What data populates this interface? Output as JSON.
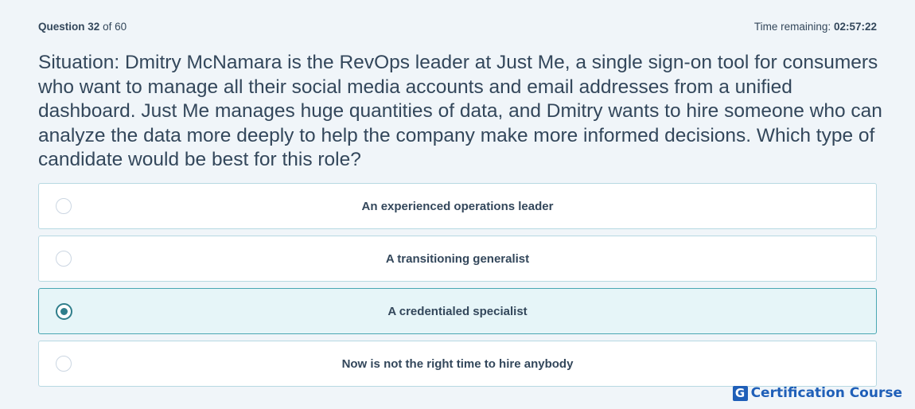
{
  "header": {
    "question_word": "Question",
    "question_number": "32",
    "question_of": "of 60",
    "time_label": "Time remaining:",
    "time_value": "02:57:22"
  },
  "question": {
    "text": "Situation: Dmitry McNamara is the RevOps leader at Just Me, a single sign-on tool for consumers who want to manage all their social media accounts and email addresses from a unified dashboard. Just Me manages huge quantities of data, and Dmitry wants to hire someone who can analyze the data more deeply to help the company make more informed decisions. Which type of candidate would be best for this role?"
  },
  "options": [
    {
      "label": "An experienced operations leader",
      "selected": false
    },
    {
      "label": "A transitioning generalist",
      "selected": false
    },
    {
      "label": "A credentialed specialist",
      "selected": true
    },
    {
      "label": "Now is not the right time to hire anybody",
      "selected": false
    }
  ],
  "brand": {
    "mark": "G",
    "name": "Certification Course"
  },
  "colors": {
    "background": "#f0f5f9",
    "text": "#33475b",
    "option_border": "#b7d9e2",
    "selected_bg": "#e6f5f8",
    "selected_accent": "#2f7e8b",
    "brand": "#1f5fb8"
  }
}
